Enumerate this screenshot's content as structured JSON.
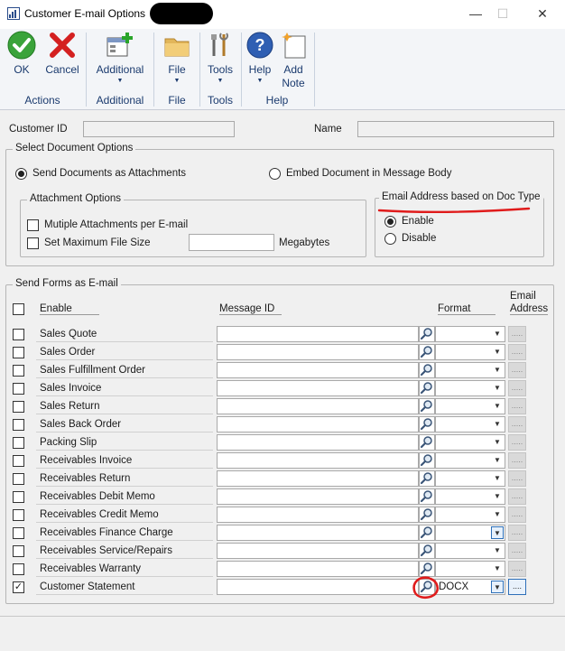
{
  "window": {
    "title": "Customer E-mail Options",
    "minimize": "—",
    "maximize": "☐",
    "close": "✕"
  },
  "ribbon": {
    "ok": "OK",
    "cancel": "Cancel",
    "additional": "Additional",
    "file": "File",
    "tools": "Tools",
    "help": "Help",
    "add_note_line1": "Add",
    "add_note_line2": "Note",
    "groups": {
      "actions": "Actions",
      "additional": "Additional",
      "file": "File",
      "tools": "Tools",
      "help": "Help"
    }
  },
  "header": {
    "customer_id_label": "Customer ID",
    "customer_id_value": "",
    "name_label": "Name",
    "name_value": ""
  },
  "document_options": {
    "title": "Select Document Options",
    "send_as_attachments": "Send Documents as Attachments",
    "embed_in_body": "Embed Document in Message Body",
    "selected": "send_as_attachments",
    "attachment_options": {
      "title": "Attachment Options",
      "multiple_attachments": "Mutiple Attachments per E-mail",
      "set_max_size": "Set Maximum File Size",
      "max_size_value": "",
      "units": "Megabytes"
    },
    "email_by_doc_type": {
      "title": "Email Address based on Doc Type",
      "enable": "Enable",
      "disable": "Disable",
      "selected": "enable"
    }
  },
  "forms": {
    "title": "Send Forms as E-mail",
    "columns": {
      "enable": "Enable",
      "message_id": "Message ID",
      "format": "Format",
      "email_line1": "Email",
      "email_line2": "Address"
    },
    "rows": [
      {
        "name": "Sales Quote",
        "checked": false,
        "format": "",
        "ellipsis": "....."
      },
      {
        "name": "Sales Order",
        "checked": false,
        "format": "",
        "ellipsis": "....."
      },
      {
        "name": "Sales Fulfillment Order",
        "checked": false,
        "format": "",
        "ellipsis": "....."
      },
      {
        "name": "Sales Invoice",
        "checked": false,
        "format": "",
        "ellipsis": "....."
      },
      {
        "name": "Sales Return",
        "checked": false,
        "format": "",
        "ellipsis": "....."
      },
      {
        "name": "Sales Back Order",
        "checked": false,
        "format": "",
        "ellipsis": "....."
      },
      {
        "name": "Packing Slip",
        "checked": false,
        "format": "",
        "ellipsis": "....."
      },
      {
        "name": "Receivables Invoice",
        "checked": false,
        "format": "",
        "ellipsis": "....."
      },
      {
        "name": "Receivables Return",
        "checked": false,
        "format": "",
        "ellipsis": "....."
      },
      {
        "name": "Receivables Debit Memo",
        "checked": false,
        "format": "",
        "ellipsis": "....."
      },
      {
        "name": "Receivables Credit Memo",
        "checked": false,
        "format": "",
        "ellipsis": "....."
      },
      {
        "name": "Receivables Finance Charge",
        "checked": false,
        "format": "",
        "ellipsis": "....."
      },
      {
        "name": "Receivables Service/Repairs",
        "checked": false,
        "format": "",
        "ellipsis": "....."
      },
      {
        "name": "Receivables Warranty",
        "checked": false,
        "format": "",
        "ellipsis": "....."
      },
      {
        "name": "Customer Statement",
        "checked": true,
        "format": "DOCX",
        "ellipsis": "...."
      }
    ]
  },
  "colors": {
    "annotation_red": "#e01b1b",
    "ribbon_text": "#1a3a6e",
    "accent_blue": "#2d6fb8"
  }
}
